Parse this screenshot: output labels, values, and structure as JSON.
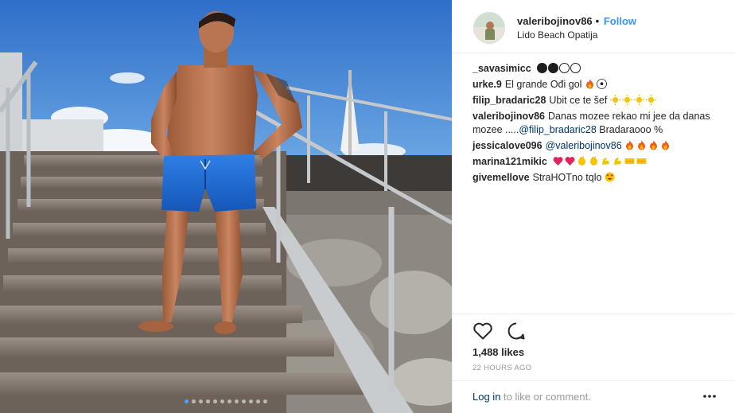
{
  "header": {
    "username": "valeribojinov86",
    "separator": "•",
    "follow_label": "Follow",
    "location": "Lido Beach Opatija"
  },
  "photo": {
    "carousel_dot_count": 12,
    "active_dot": 0
  },
  "comments": [
    {
      "user": "_savasimicc",
      "text": "",
      "emoji": [
        "filled-circle",
        "filled-circle",
        "open-circle",
        "open-circle"
      ]
    },
    {
      "user": "urke.9",
      "text": "El grande Ođi gol",
      "emoji": [
        "fire",
        "soccer-ball"
      ]
    },
    {
      "user": "filip_bradaric28",
      "text": "Ubit ce te šef",
      "emoji": [
        "sun",
        "sun",
        "sun",
        "sun"
      ]
    },
    {
      "user": "valeribojinov86",
      "text": "Danas mozee rekao mi jee da danas mozee .....",
      "mention": "@filip_bradaric28",
      "text_after": " Bradaraooo %",
      "emoji": []
    },
    {
      "user": "jessicalove096",
      "text": "",
      "mention": "@valeribojinov86",
      "emoji": [
        "fire",
        "fire",
        "fire",
        "fire"
      ]
    },
    {
      "user": "marina121mikic",
      "text": "",
      "emoji": [
        "heart",
        "heart",
        "clap",
        "clap",
        "flex",
        "flex",
        "hundred",
        "hundred"
      ]
    },
    {
      "user": "givemellove",
      "text": "StraHOTno tqlo",
      "emoji": [
        "heart-eyes"
      ]
    }
  ],
  "actions": {
    "likes": "1,488 likes",
    "timestamp": "22 HOURS AGO"
  },
  "footer": {
    "login_link": "Log in",
    "login_rest": " to like or comment."
  },
  "colors": {
    "accent": "#3897f0",
    "mention": "#003569",
    "muted": "#999999",
    "text": "#262626",
    "divider": "#efefef"
  }
}
